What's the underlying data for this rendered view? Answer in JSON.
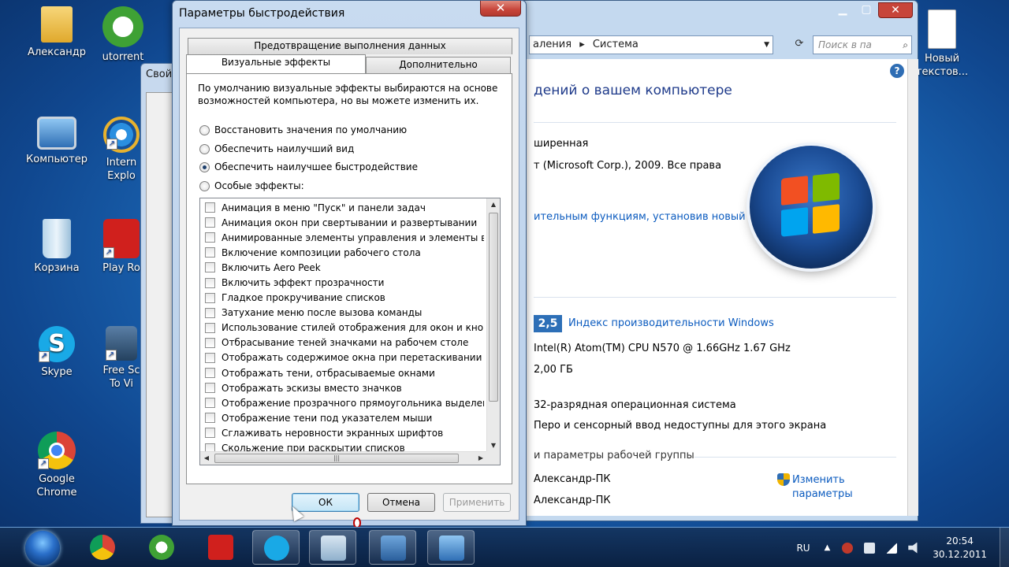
{
  "desktop": {
    "icons": [
      {
        "label": "Александр"
      },
      {
        "label": "utorrent"
      },
      {
        "label": "Компьютер"
      },
      {
        "label": "Intern Explo"
      },
      {
        "label": "Корзина"
      },
      {
        "label": "Play Ro"
      },
      {
        "label": "Skype"
      },
      {
        "label": "Free Sc To Vi"
      },
      {
        "label": "Google Chrome"
      },
      {
        "label": "Новый текстов..."
      }
    ]
  },
  "behind_dialog": {
    "title": "Свой"
  },
  "system_window": {
    "breadcrumb_part1": "аления",
    "breadcrumb_sep": "▸",
    "breadcrumb_part2": "Система",
    "search_placeholder": "Поиск в па",
    "heading": "дений о вашем компьютере",
    "edition": "ширенная",
    "copyright": "т (Microsoft Corp.), 2009. Все права",
    "upgrade_link": "ительным функциям, установив новый",
    "perf_score": "2,5",
    "perf_link": "Индекс производительности Windows",
    "cpu": "Intel(R) Atom(TM) CPU N570   @ 1.66GHz   1.67 GHz",
    "ram": "2,00 ГБ",
    "os_type": "32-разрядная операционная система",
    "pen_touch": "Перо и сенсорный ввод недоступны для этого экрана",
    "workgroup_heading": "и параметры рабочей группы",
    "computer_name": "Александр-ПК",
    "full_name": "Александр-ПК",
    "change_link_1": "Изменить",
    "change_link_2": "параметры"
  },
  "dialog": {
    "title": "Параметры быстродействия",
    "close_glyph": "✕",
    "tabs": {
      "dep": "Предотвращение выполнения данных",
      "visual": "Визуальные эффекты",
      "advanced": "Дополнительно"
    },
    "description": "По умолчанию визуальные эффекты выбираются на основе возможностей компьютера, но вы можете изменить их.",
    "radios": [
      {
        "label": "Восстановить значения по умолчанию",
        "checked": false
      },
      {
        "label": "Обеспечить наилучший вид",
        "checked": false
      },
      {
        "label": "Обеспечить наилучшее быстродействие",
        "checked": true
      },
      {
        "label": "Особые эффекты:",
        "checked": false
      }
    ],
    "effects": [
      "Анимация в меню \"Пуск\" и панели задач",
      "Анимация окон при свертывании и развертывании",
      "Анимированные элементы управления и элементы вну",
      "Включение композиции рабочего стола",
      "Включить Aero Peek",
      "Включить эффект прозрачности",
      "Гладкое прокручивание списков",
      "Затухание меню после вызова команды",
      "Использование стилей отображения для окон и кнопок",
      "Отбрасывание теней значками на рабочем столе",
      "Отображать содержимое окна при перетаскивании",
      "Отображать тени, отбрасываемые окнами",
      "Отображать эскизы вместо значков",
      "Отображение прозрачного прямоугольника выделени",
      "Отображение тени под указателем мыши",
      "Сглаживать неровности экранных шрифтов",
      "Скольжение при раскрытии списков"
    ],
    "buttons": {
      "ok": "ОК",
      "cancel": "Отмена",
      "apply": "Применить"
    }
  },
  "taskbar": {
    "language": "RU",
    "time": "20:54",
    "date": "30.12.2011"
  },
  "colors": {
    "accent": "#0b5bbf",
    "close_red": "#c7453a"
  }
}
